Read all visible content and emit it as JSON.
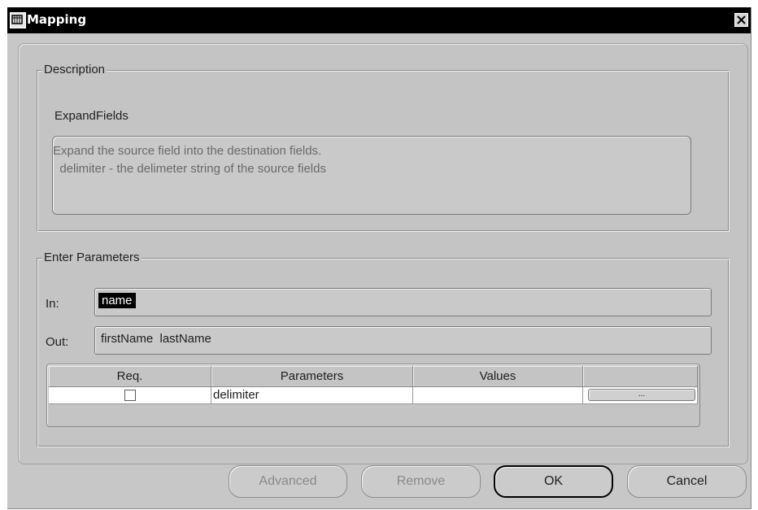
{
  "window": {
    "title": "Mapping",
    "icon": "app-icon",
    "close_icon": "close-icon"
  },
  "description": {
    "legend": "Description",
    "name": "ExpandFields",
    "text_lines": [
      "Expand the source field into the destination fields.",
      "  delimiter - the delimeter string of the source fields"
    ]
  },
  "parameters": {
    "legend": "Enter Parameters",
    "in_label": "In:",
    "in_value": "name",
    "out_label": "Out:",
    "out_value": "firstName  lastName",
    "table": {
      "columns": [
        "Req.",
        "Parameters",
        "Values",
        ""
      ],
      "rows": [
        {
          "req": false,
          "parameter": "delimiter",
          "value": "",
          "button_label": "..."
        }
      ]
    }
  },
  "buttons": {
    "advanced": "Advanced",
    "remove": "Remove",
    "ok": "OK",
    "cancel": "Cancel"
  }
}
